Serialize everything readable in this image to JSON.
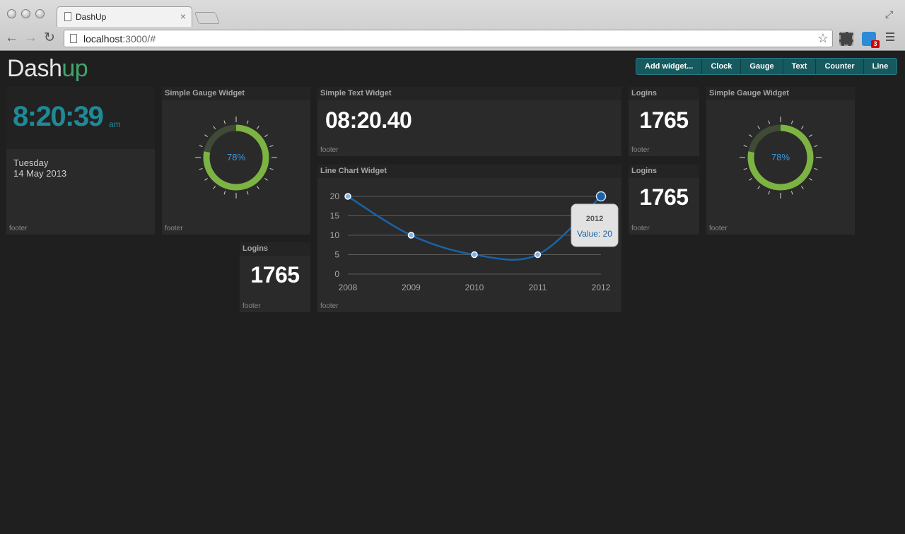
{
  "browser": {
    "tab_title": "DashUp",
    "url_host": "localhost",
    "url_rest": ":3000/#",
    "extension_badge": "3"
  },
  "app": {
    "logo_part1": "Dash",
    "logo_part2": "up",
    "buttons": [
      "Add widget...",
      "Clock",
      "Gauge",
      "Text",
      "Counter",
      "Line"
    ],
    "colors": {
      "accent_teal": "#1f8a96",
      "logo_green": "#3fa56b",
      "gauge_green": "#7cb342",
      "line_blue": "#1a63a8"
    }
  },
  "widgets": {
    "clock": {
      "time": "8:20:39",
      "ampm": "am",
      "day": "Tuesday",
      "date": "14 May 2013",
      "footer": "footer"
    },
    "gauge1": {
      "title": "Simple Gauge Widget",
      "value_label": "78%",
      "value": 0.78,
      "footer": "footer"
    },
    "text1": {
      "title": "Simple Text Widget",
      "text": "08:20.40",
      "footer": "footer"
    },
    "logins1": {
      "title": "Logins",
      "value": "1765",
      "footer": "footer"
    },
    "logins2": {
      "title": "Logins",
      "value": "1765",
      "footer": "footer"
    },
    "logins3": {
      "title": "Logins",
      "value": "1765",
      "footer": "footer"
    },
    "gauge2": {
      "title": "Simple Gauge Widget",
      "value_label": "78%",
      "value": 0.78,
      "footer": "footer"
    },
    "linechart": {
      "title": "Line Chart Widget",
      "footer": "footer",
      "tooltip_year": "2012",
      "tooltip_value": "Value: 20"
    }
  },
  "chart_data": {
    "type": "line",
    "x": [
      2008,
      2009,
      2010,
      2011,
      2012
    ],
    "categories": [
      "2008",
      "2009",
      "2010",
      "2011",
      "2012"
    ],
    "series": [
      {
        "values": [
          20,
          10,
          5,
          5,
          20
        ]
      }
    ],
    "yticks": [
      "0",
      "5",
      "10",
      "15",
      "20"
    ],
    "ylim": [
      0,
      20
    ],
    "grid": true,
    "xlabel": "",
    "ylabel": ""
  }
}
